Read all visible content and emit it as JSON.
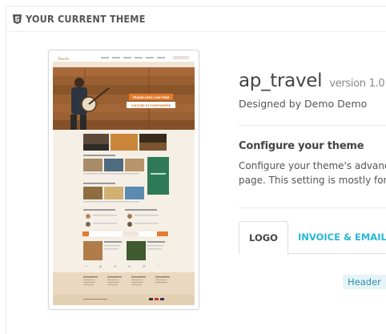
{
  "panel": {
    "title": "YOUR CURRENT THEME"
  },
  "theme": {
    "name": "ap_travel",
    "version": "version 1.0",
    "designed_by": "Designed by Demo Demo"
  },
  "configure": {
    "title": "Configure your theme",
    "line1": "Configure your theme's advanced",
    "line2": "page. This setting is mostly for a"
  },
  "thumbnail": {
    "logo": "Travels",
    "hero_line1": "TRAVELLERS CAN FIND",
    "hero_line2": "CULTURE IN EVERYWHERE"
  },
  "tabs": [
    {
      "label": "LOGO"
    },
    {
      "label": "INVOICE & EMAIL LO"
    }
  ],
  "header_label": "Header",
  "colors": {
    "accent": "#25b9d7",
    "hero": "#8b5a2b",
    "footer": "#ead9c0"
  }
}
